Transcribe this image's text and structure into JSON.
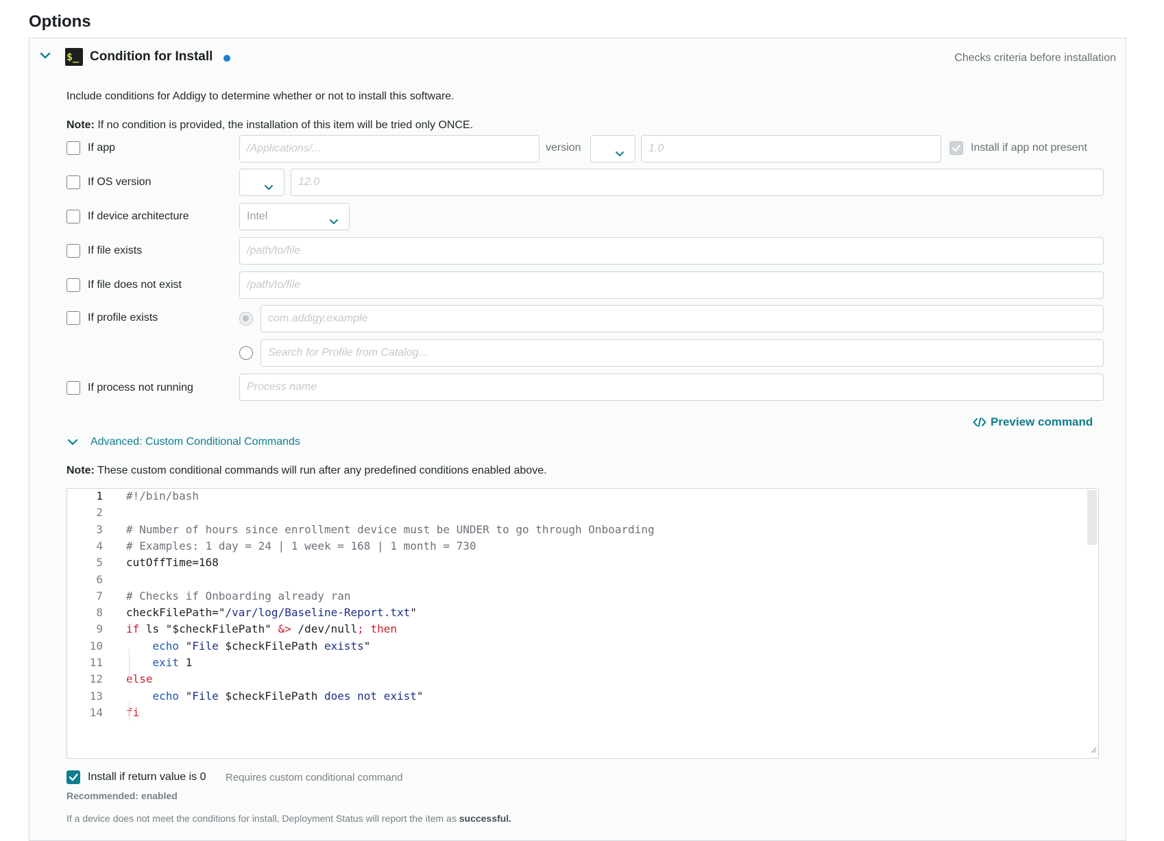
{
  "page": {
    "title": "Options"
  },
  "section": {
    "title": "Condition for Install",
    "terminal_glyph": "$_",
    "description": "Checks criteria before installation",
    "intro": "Include conditions for Addigy to determine whether or not to install this software.",
    "note_prefix": "Note:",
    "note_text": " If no condition is provided, the installation of this item will be tried only ONCE."
  },
  "conditions": {
    "if_app": {
      "label": "If app",
      "checked": false,
      "path_placeholder": "/Applications/...",
      "version_label": "version",
      "version_placeholder": "1.0",
      "install_if_absent_label": "Install if app not present"
    },
    "if_os_version": {
      "label": "If OS version",
      "checked": false,
      "version_placeholder": "12.0"
    },
    "if_device_architecture": {
      "label": "If device architecture",
      "checked": false,
      "selected": "Intel"
    },
    "if_file_exists": {
      "label": "If file exists",
      "checked": false,
      "placeholder": "/path/to/file"
    },
    "if_file_not_exist": {
      "label": "If file does not exist",
      "checked": false,
      "placeholder": "/path/to/file"
    },
    "if_profile_exists": {
      "label": "If profile exists",
      "checked": false,
      "identifier_placeholder": "com.addigy.example",
      "catalog_placeholder": "Search for Profile from Catalog..."
    },
    "if_process_not_running": {
      "label": "If process not running",
      "checked": false,
      "placeholder": "Process name"
    }
  },
  "preview_command": {
    "label": "Preview command",
    "icon": "code-icon"
  },
  "advanced": {
    "label": "Advanced: Custom Conditional Commands",
    "note_prefix": "Note:",
    "note_text": " These custom conditional commands will run after any predefined conditions enabled above."
  },
  "editor": {
    "lines": [
      {
        "n": "1",
        "text": "#!/bin/bash"
      },
      {
        "n": "2",
        "text": ""
      },
      {
        "n": "3",
        "text": "# Number of hours since enrollment device must be UNDER to go through Onboarding"
      },
      {
        "n": "4",
        "text": "# Examples: 1 day = 24 | 1 week = 168 | 1 month = 730"
      },
      {
        "n": "5",
        "text": "cutOffTime=168"
      },
      {
        "n": "6",
        "text": ""
      },
      {
        "n": "7",
        "text": "# Checks if Onboarding already ran"
      },
      {
        "n": "8",
        "text": "checkFilePath=\"/var/log/Baseline-Report.txt\""
      },
      {
        "n": "9",
        "text": "if ls \"$checkFilePath\" &> /dev/null; then"
      },
      {
        "n": "10",
        "text": "    echo \"File $checkFilePath exists\""
      },
      {
        "n": "11",
        "text": "    exit 1"
      },
      {
        "n": "12",
        "text": "else"
      },
      {
        "n": "13",
        "text": "    echo \"File $checkFilePath does not exist\""
      },
      {
        "n": "14",
        "text": "fi"
      }
    ]
  },
  "footer": {
    "install_if_zero_label": "Install if return value is 0",
    "install_if_zero_checked": true,
    "install_if_zero_hint": "Requires custom conditional command",
    "recommended": "Recommended: enabled",
    "footnote_text": "If a device does not meet the conditions for install, Deployment Status will report the item as ",
    "footnote_strong": "successful."
  },
  "colors": {
    "accent": "#0e7d8c",
    "status_dot": "#1a7fd4",
    "keyword": "#c8202f",
    "string": "#1b2f8a"
  }
}
